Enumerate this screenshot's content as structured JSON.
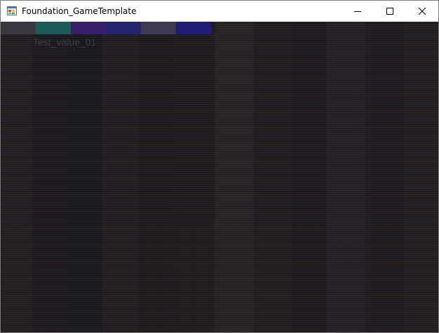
{
  "window": {
    "title": "Foundation_GameTemplate",
    "icon": "windows-forms-app-icon"
  },
  "caption_buttons": {
    "minimize_icon": "minimize-icon",
    "maximize_icon": "maximize-icon",
    "close_icon": "close-icon"
  },
  "game": {
    "swatches": [
      {
        "color": "#3a3840"
      },
      {
        "color": "#1f5a5a"
      },
      {
        "color": "#3a1f6a"
      },
      {
        "color": "#23236e"
      },
      {
        "color": "#3d3a52"
      },
      {
        "color": "#1e1e78"
      }
    ],
    "test_label": "Test_value_01"
  }
}
